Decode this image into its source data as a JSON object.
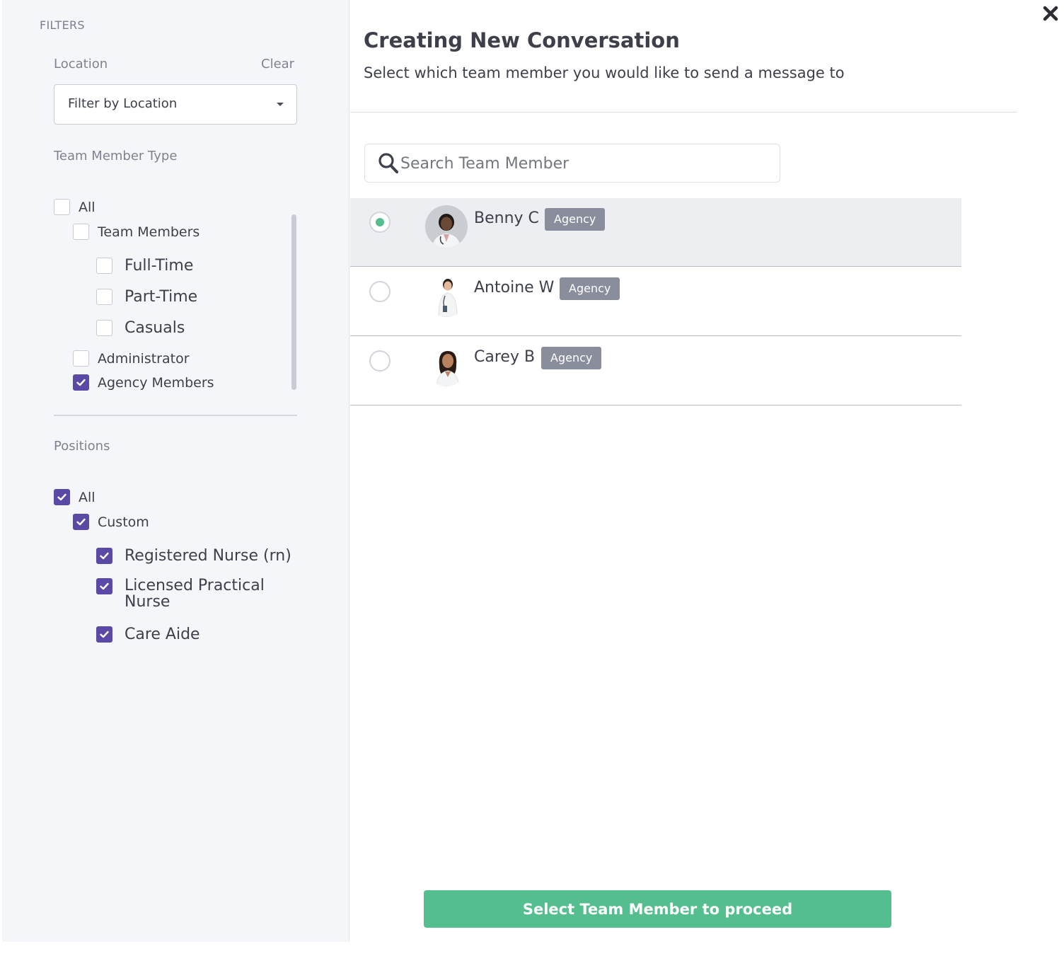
{
  "sidebar": {
    "title": "FILTERS",
    "location": {
      "label": "Location",
      "clear_label": "Clear",
      "select_value": "Filter by Location"
    },
    "member_type": {
      "label": "Team Member Type",
      "options": [
        {
          "label": "All",
          "checked": false
        },
        {
          "label": "Team Members",
          "checked": false
        },
        {
          "label": "Full-Time",
          "checked": false
        },
        {
          "label": "Part-Time",
          "checked": false
        },
        {
          "label": "Casuals",
          "checked": false
        },
        {
          "label": "Administrator",
          "checked": false
        },
        {
          "label": "Agency Members",
          "checked": true
        }
      ]
    },
    "positions": {
      "label": "Positions",
      "options": [
        {
          "label": "All",
          "checked": true
        },
        {
          "label": "Custom",
          "checked": true
        },
        {
          "label": "Registered Nurse (rn)",
          "checked": true
        },
        {
          "label": "Licensed Practical Nurse",
          "checked": true
        },
        {
          "label": "Care Aide",
          "checked": true
        }
      ]
    }
  },
  "main": {
    "title": "Creating New Conversation",
    "subtitle": "Select which team member you would like to send a message to",
    "search": {
      "placeholder": "Search Team Member",
      "value": ""
    },
    "members": [
      {
        "name": "Benny C",
        "badge": "Agency",
        "selected": true
      },
      {
        "name": "Antoine W",
        "badge": "Agency",
        "selected": false
      },
      {
        "name": "Carey B",
        "badge": "Agency",
        "selected": false
      }
    ],
    "proceed_label": "Select Team Member to proceed"
  },
  "colors": {
    "accent_green": "#55be8e",
    "checkbox_purple": "#5a4aa6",
    "badge_gray": "#8a8e9c",
    "sidebar_bg": "#f5f6fa"
  },
  "icons": {
    "close": "close-icon",
    "search": "search-icon",
    "caret": "chevron-down-icon",
    "check": "checkmark-icon"
  }
}
